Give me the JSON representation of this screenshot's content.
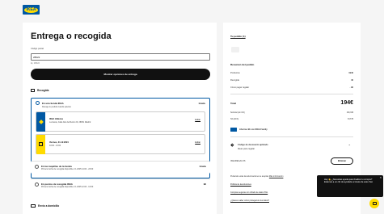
{
  "brand": {
    "logo_text": "IKEA"
  },
  "main": {
    "title": "Entrega o recogida",
    "postal_label": "Código postal",
    "postal_value": "28022",
    "postal_hint": "Ej. 28022",
    "show_button": "Mostrar opciones de entrega",
    "pickup_title": "Recogida",
    "options": [
      {
        "title": "En una tienda IKEA",
        "subtitle": "Recoge tu pedido cuando quieras",
        "price": "Gratis",
        "store_name": "IKEA Vallecas",
        "store_addr": "La Gavia, Calle Alto del Retiro 20, 28051 Madrid",
        "store_edit": "Editar",
        "date_label": "Viernes, 31.12.2024",
        "time_label": "10:00 - 13:00",
        "date_edit": "Editar"
      },
      {
        "title": "En las taquillas de la tienda",
        "subtitle": "Primera fecha de recogida disponible 2.1.2025 14:00 - 23:00",
        "price": "Gratis"
      },
      {
        "title": "En puntos de recogida IKEA",
        "subtitle": "Primera fecha de recogida disponible 2.1.2025 12:00 - 13:00",
        "price": "9€"
      }
    ],
    "delivery_title": "Envío a domicilio"
  },
  "summary": {
    "order_title": "Tu pedido (1)",
    "summary_title": "Resumen del pedido",
    "rows": [
      {
        "label": "Productos",
        "value": "194€"
      },
      {
        "label": "Recogida",
        "value": "4€"
      },
      {
        "label": "Cómo pagar regalar",
        "value": "- 9€"
      }
    ],
    "total_label": "Total",
    "total_value": "194€",
    "tax_rows": [
      {
        "label": "Subtotal (sin IVA)",
        "value": "160,33€"
      },
      {
        "label": "IVA (21%)",
        "value": "33,67€"
      }
    ],
    "family_text": "Ahorras 9€ con IKEA Family",
    "discount_title": "Código de descuento aplicado",
    "discount_sub": "Ideas para regalar",
    "discount_code": "IKEAREGALOS",
    "remove_label": "Eliminar",
    "terms_text": "Pulsando estas las alumnaciones te aceptas",
    "terms_link": "Más información",
    "links": [
      "Política de devoluciones",
      "Compras seguras con cifrado de datos SSL",
      "¿Quieres saber cómo protegemos tus datos?"
    ]
  },
  "chat": {
    "text": "Hey 👋 ¿Necesitas ayuda para finalizar tu compra? Estamos a un clic de ayudarte a través de este chat."
  }
}
